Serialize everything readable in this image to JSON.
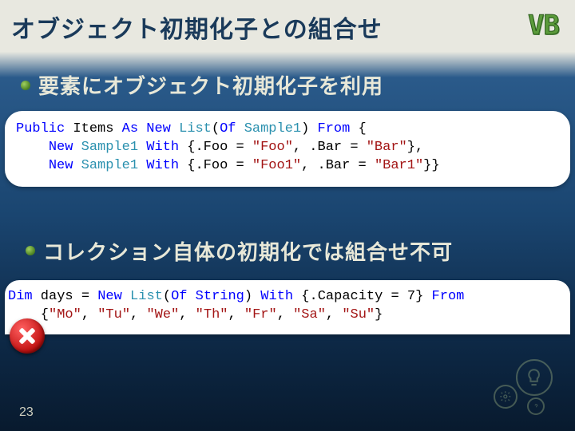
{
  "title": "オブジェクト初期化子との組合せ",
  "badge": "VB",
  "bullets": [
    "要素にオブジェクト初期化子を利用",
    "コレクション自体の初期化では組合せ不可"
  ],
  "code1": {
    "tokens": [
      {
        "t": "Public",
        "c": "kw"
      },
      {
        "t": " Items "
      },
      {
        "t": "As",
        "c": "kw"
      },
      {
        "t": " "
      },
      {
        "t": "New",
        "c": "kw"
      },
      {
        "t": " "
      },
      {
        "t": "List",
        "c": "type"
      },
      {
        "t": "("
      },
      {
        "t": "Of",
        "c": "kw"
      },
      {
        "t": " "
      },
      {
        "t": "Sample1",
        "c": "type"
      },
      {
        "t": ") "
      },
      {
        "t": "From",
        "c": "kw"
      },
      {
        "t": " {\n    "
      },
      {
        "t": "New",
        "c": "kw"
      },
      {
        "t": " "
      },
      {
        "t": "Sample1",
        "c": "type"
      },
      {
        "t": " "
      },
      {
        "t": "With",
        "c": "kw"
      },
      {
        "t": " {.Foo = "
      },
      {
        "t": "\"Foo\"",
        "c": "str"
      },
      {
        "t": ", .Bar = "
      },
      {
        "t": "\"Bar\"",
        "c": "str"
      },
      {
        "t": "},\n    "
      },
      {
        "t": "New",
        "c": "kw"
      },
      {
        "t": " "
      },
      {
        "t": "Sample1",
        "c": "type"
      },
      {
        "t": " "
      },
      {
        "t": "With",
        "c": "kw"
      },
      {
        "t": " {.Foo = "
      },
      {
        "t": "\"Foo1\"",
        "c": "str"
      },
      {
        "t": ", .Bar = "
      },
      {
        "t": "\"Bar1\"",
        "c": "str"
      },
      {
        "t": "}}"
      }
    ]
  },
  "code2": {
    "tokens": [
      {
        "t": "Dim",
        "c": "kw"
      },
      {
        "t": " days = "
      },
      {
        "t": "New",
        "c": "kw"
      },
      {
        "t": " "
      },
      {
        "t": "List",
        "c": "type"
      },
      {
        "t": "("
      },
      {
        "t": "Of",
        "c": "kw"
      },
      {
        "t": " "
      },
      {
        "t": "String",
        "c": "kw"
      },
      {
        "t": ") "
      },
      {
        "t": "With",
        "c": "kw"
      },
      {
        "t": " {.Capacity = 7} "
      },
      {
        "t": "From",
        "c": "kw"
      },
      {
        "t": "\n    {"
      },
      {
        "t": "\"Mo\"",
        "c": "str"
      },
      {
        "t": ", "
      },
      {
        "t": "\"Tu\"",
        "c": "str"
      },
      {
        "t": ", "
      },
      {
        "t": "\"We\"",
        "c": "str"
      },
      {
        "t": ", "
      },
      {
        "t": "\"Th\"",
        "c": "str"
      },
      {
        "t": ", "
      },
      {
        "t": "\"Fr\"",
        "c": "str"
      },
      {
        "t": ", "
      },
      {
        "t": "\"Sa\"",
        "c": "str"
      },
      {
        "t": ", "
      },
      {
        "t": "\"Su\"",
        "c": "str"
      },
      {
        "t": "}"
      }
    ]
  },
  "page_number": "23"
}
